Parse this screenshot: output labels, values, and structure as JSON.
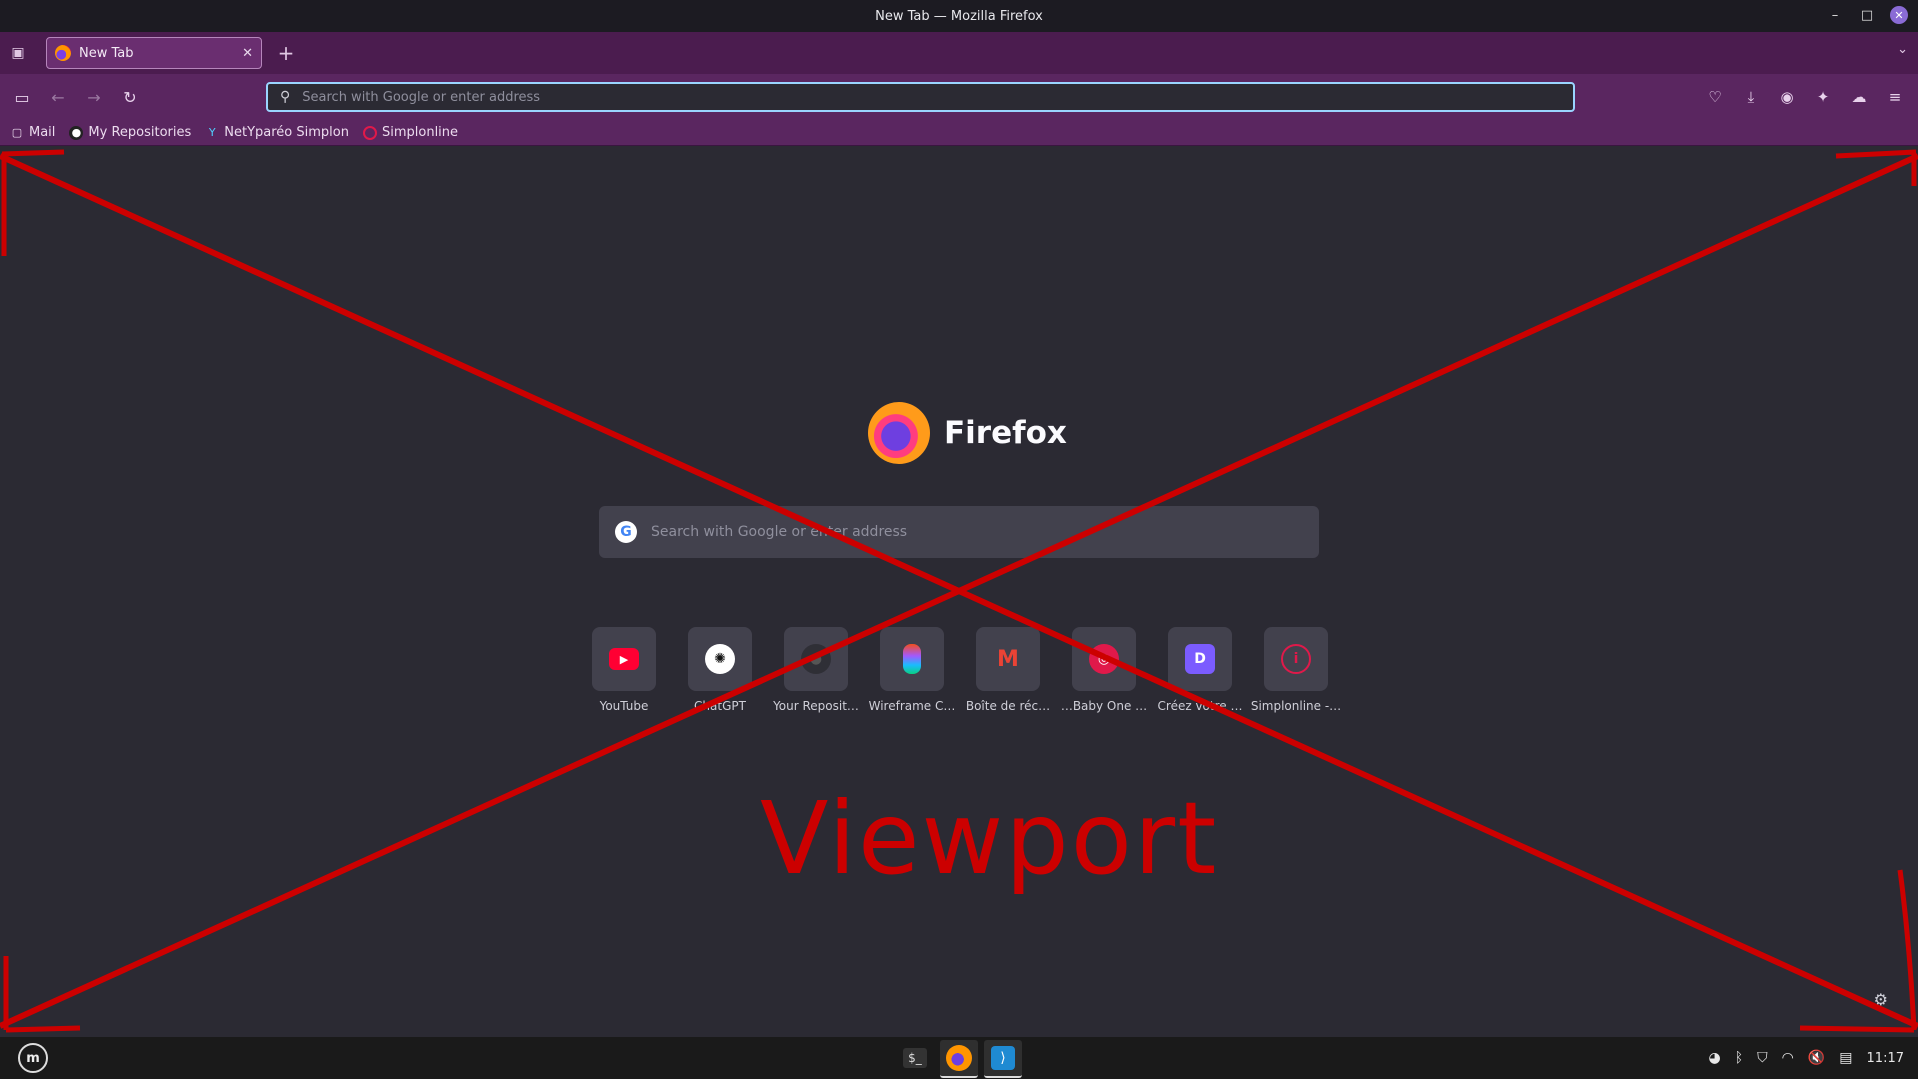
{
  "window": {
    "title": "New Tab — Mozilla Firefox"
  },
  "tabs": [
    {
      "label": "New Tab"
    }
  ],
  "urlbar": {
    "placeholder": "Search with Google or enter address"
  },
  "bookmarks": [
    {
      "label": "Mail",
      "icon": "folder-icon"
    },
    {
      "label": "My Repositories",
      "icon": "github-icon"
    },
    {
      "label": "NetYparéo Simplon",
      "icon": "netypareo-icon"
    },
    {
      "label": "Simplonline",
      "icon": "simplonline-icon"
    }
  ],
  "newtab": {
    "brand": "Firefox",
    "search_placeholder": "Search with Google or enter address",
    "top_sites": [
      {
        "label": "YouTube"
      },
      {
        "label": "ChatGPT"
      },
      {
        "label": "Your Reposit…"
      },
      {
        "label": "Wireframe C…"
      },
      {
        "label": "Boîte de réc…"
      },
      {
        "label": "…Baby One …"
      },
      {
        "label": "Créez votre …"
      },
      {
        "label": "Simplonline -…"
      }
    ]
  },
  "annotation": {
    "label": "Viewport",
    "color": "#cc0000"
  },
  "taskbar": {
    "clock": "11:17"
  },
  "colors": {
    "tabbar": "#4b1c4f",
    "toolbar": "#5a2660",
    "content": "#2b2a33",
    "focus": "#9ad4ff"
  }
}
